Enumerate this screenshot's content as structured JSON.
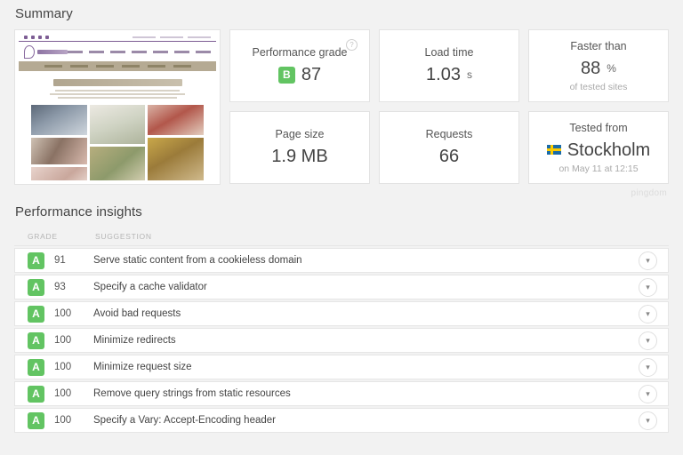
{
  "summary": {
    "title": "Summary",
    "thumbnail": {
      "site_name": "Stylehome",
      "page_heading": "Fabrics: Traditional Fabrics"
    },
    "cards": [
      {
        "name": "performance-grade",
        "label": "Performance grade",
        "badge": "B",
        "value": "87",
        "unit": "",
        "sub": "",
        "help_icon": "?",
        "badge_color": "#62c462"
      },
      {
        "name": "load-time",
        "label": "Load time",
        "value": "1.03",
        "unit": "s",
        "sub": ""
      },
      {
        "name": "faster-than",
        "label": "Faster than",
        "value": "88",
        "unit": "%",
        "sub": "of tested sites"
      },
      {
        "name": "page-size",
        "label": "Page size",
        "value": "1.9 MB",
        "unit": "",
        "sub": ""
      },
      {
        "name": "requests",
        "label": "Requests",
        "value": "66",
        "unit": "",
        "sub": ""
      },
      {
        "name": "tested-from",
        "label": "Tested from",
        "value": "Stockholm",
        "unit": "",
        "sub": "on May 11 at 12:15",
        "flag": "sweden-flag"
      }
    ],
    "watermark": "pingdom"
  },
  "insights": {
    "title": "Performance insights",
    "columns": {
      "grade": "GRADE",
      "suggestion": "SUGGESTION"
    },
    "expand_icon": "chevron-down-icon",
    "rows": [
      {
        "grade": "A",
        "score": "91",
        "suggestion": "Serve static content from a cookieless domain"
      },
      {
        "grade": "A",
        "score": "93",
        "suggestion": "Specify a cache validator"
      },
      {
        "grade": "A",
        "score": "100",
        "suggestion": "Avoid bad requests"
      },
      {
        "grade": "A",
        "score": "100",
        "suggestion": "Minimize redirects"
      },
      {
        "grade": "A",
        "score": "100",
        "suggestion": "Minimize request size"
      },
      {
        "grade": "A",
        "score": "100",
        "suggestion": "Remove query strings from static resources"
      },
      {
        "grade": "A",
        "score": "100",
        "suggestion": "Specify a Vary: Accept-Encoding header"
      }
    ]
  },
  "colors": {
    "grade_green": "#62c462",
    "page_background": "#f2f2f2",
    "card_background": "#ffffff"
  }
}
